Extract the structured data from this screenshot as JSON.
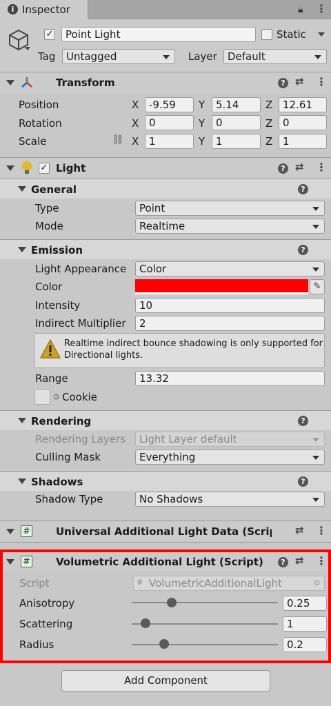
{
  "tab": {
    "label": "Inspector",
    "lock_icon": "lock-icon",
    "menu_icon": "kebab-menu-icon"
  },
  "object": {
    "name": "Point Light",
    "active": true,
    "static_label": "Static",
    "static_checked": false,
    "tag_label": "Tag",
    "tag_value": "Untagged",
    "layer_label": "Layer",
    "layer_value": "Default"
  },
  "transform": {
    "title": "Transform",
    "position_label": "Position",
    "rotation_label": "Rotation",
    "scale_label": "Scale",
    "axis_x": "X",
    "axis_y": "Y",
    "axis_z": "Z",
    "position": {
      "x": "-9.59",
      "y": "5.14",
      "z": "12.61"
    },
    "rotation": {
      "x": "0",
      "y": "0",
      "z": "0"
    },
    "scale": {
      "x": "1",
      "y": "1",
      "z": "1"
    }
  },
  "light": {
    "title": "Light",
    "enabled": true,
    "general": {
      "title": "General",
      "type_label": "Type",
      "type_value": "Point",
      "mode_label": "Mode",
      "mode_value": "Realtime"
    },
    "emission": {
      "title": "Emission",
      "appearance_label": "Light Appearance",
      "appearance_value": "Color",
      "color_label": "Color",
      "color_value": "#ff0000",
      "intensity_label": "Intensity",
      "intensity_value": "10",
      "indirect_label": "Indirect Multiplier",
      "indirect_value": "2",
      "warning": "Realtime indirect bounce shadowing is only supported for Directional lights.",
      "range_label": "Range",
      "range_value": "13.32",
      "cookie_label": "Cookie"
    },
    "rendering": {
      "title": "Rendering",
      "layers_label": "Rendering Layers",
      "layers_value": "Light Layer default",
      "culling_label": "Culling Mask",
      "culling_value": "Everything"
    },
    "shadows": {
      "title": "Shadows",
      "type_label": "Shadow Type",
      "type_value": "No Shadows"
    }
  },
  "universal": {
    "title": "Universal Additional Light Data (Script)"
  },
  "volumetric": {
    "title": "Volumetric Additional Light (Script)",
    "script_label": "Script",
    "script_value": "VolumetricAdditionalLight",
    "anisotropy_label": "Anisotropy",
    "anisotropy_value": "0.25",
    "scattering_label": "Scattering",
    "scattering_value": "1",
    "radius_label": "Radius",
    "radius_value": "0.2"
  },
  "add_component_label": "Add Component",
  "colors": {
    "highlight": "#ff0000",
    "light_color": "#ff0000"
  }
}
